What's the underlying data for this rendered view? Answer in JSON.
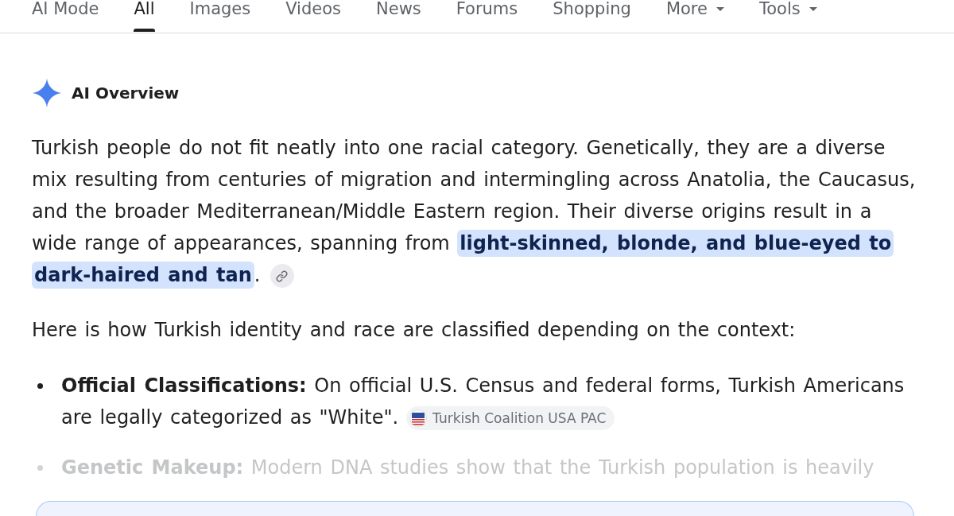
{
  "tabs": [
    {
      "label": "AI Mode",
      "selected": false,
      "dropdown": false
    },
    {
      "label": "All",
      "selected": true,
      "dropdown": false
    },
    {
      "label": "Images",
      "selected": false,
      "dropdown": false
    },
    {
      "label": "Videos",
      "selected": false,
      "dropdown": false
    },
    {
      "label": "News",
      "selected": false,
      "dropdown": false
    },
    {
      "label": "Forums",
      "selected": false,
      "dropdown": false
    },
    {
      "label": "Shopping",
      "selected": false,
      "dropdown": false
    },
    {
      "label": "More",
      "selected": false,
      "dropdown": true
    },
    {
      "label": "Tools",
      "selected": false,
      "dropdown": true
    }
  ],
  "overview": {
    "title": "AI Overview",
    "paragraphs": [
      {
        "segments": [
          {
            "text": "Turkish people do not fit neatly into one racial category. Genetically, they are a diverse mix resulting from centuries of migration and intermingling across Anatolia, the Caucasus, and the broader Mediterranean/Middle Eastern region. Their diverse origins result in a wide range of appearances, spanning from ",
            "highlighted": false
          },
          {
            "text": "light-skinned, blonde, and blue-eyed to dark-haired and tan",
            "highlighted": true
          },
          {
            "text": ".",
            "highlighted": false
          }
        ],
        "source_link": true
      },
      {
        "segments": [
          {
            "text": "Here is how Turkish identity and race are classified depending on the context:",
            "highlighted": false
          }
        ],
        "source_link": false
      }
    ],
    "points": [
      {
        "text": "**Official Classifications:** On official U.S. Census and federal forms, Turkish Americans are legally categorized as \"White\".",
        "source": "Turkish Coalition USA PAC",
        "faded": false
      },
      {
        "text": "**Genetic Makeup:** Modern DNA studies show that the Turkish population is heavily",
        "faded": true
      }
    ]
  }
}
